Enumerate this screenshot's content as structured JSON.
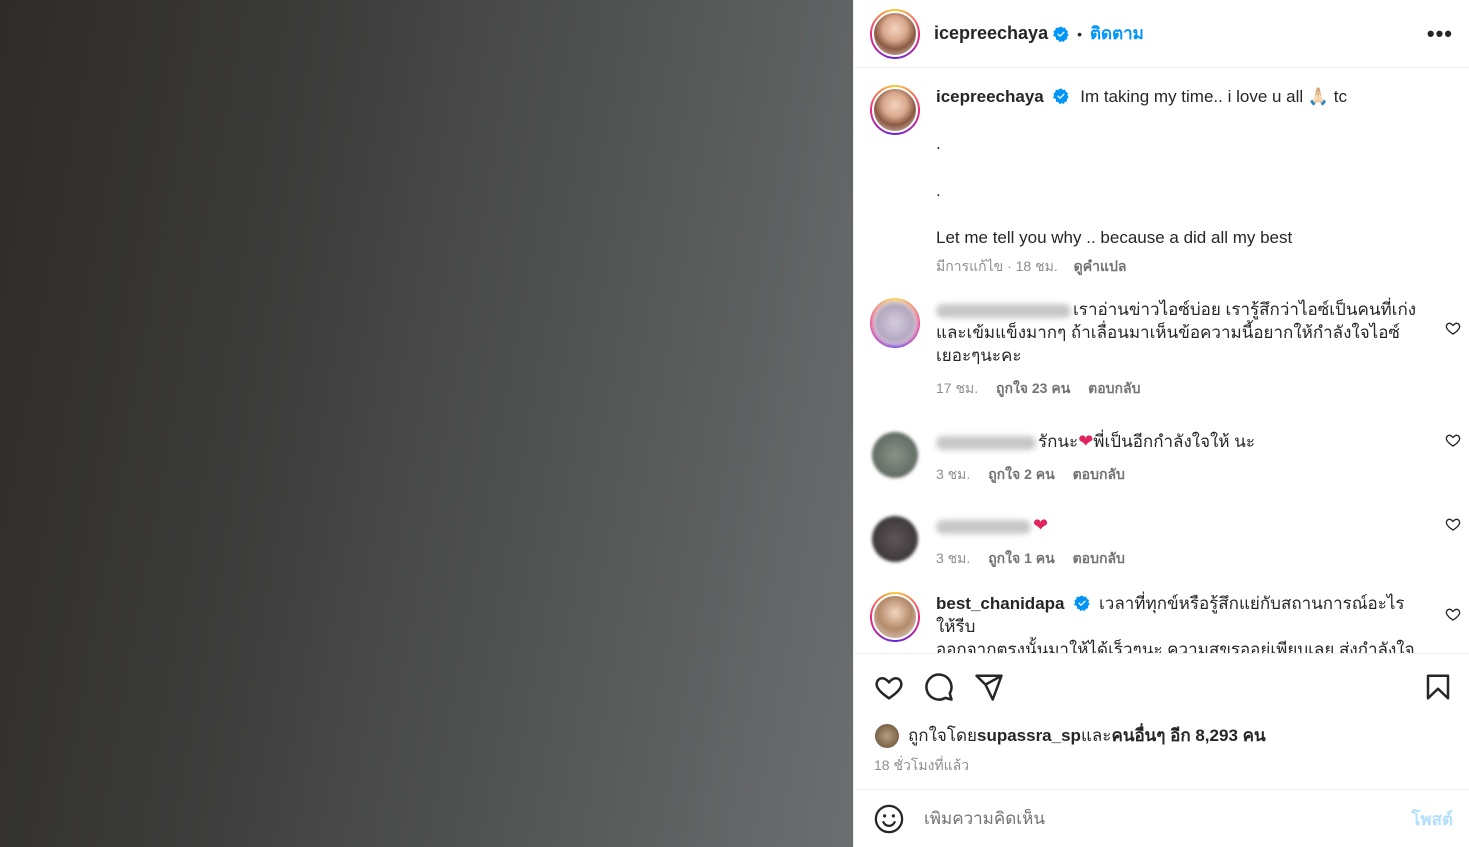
{
  "header": {
    "username": "icepreechaya",
    "dot": "•",
    "follow_label": "ติดตาม",
    "more_icon": "more-horizontal-icon"
  },
  "caption": {
    "username": "icepreechaya",
    "line1": "Im taking my time.. i love u all 🙏🏻 tc",
    "line2": ".",
    "line3": ".",
    "line4": "Let me tell you why .. because a did all my best",
    "edited": "มีการแก้ไข · 18 ชม.",
    "translate": "ดูคำแปล"
  },
  "comments": [
    {
      "text_line1": "เราอ่านข่าวไอซ์บ่อย เรารู้สึกว่าไอซ์เป็นคนที่เก่ง",
      "text_line2": "และเข้มแข็งมากๆ ถ้าเลื่อนมาเห็นข้อความนี้อยากให้กำลังใจไอซ์",
      "text_line3": "เยอะๆนะคะ",
      "time": "17 ชม.",
      "likes": "ถูกใจ 23 คน",
      "reply": "ตอบกลับ"
    },
    {
      "text_a": "รักนะ",
      "text_b": "พี่เป็นอีกกำลังใจให้ นะ",
      "time": "3 ชม.",
      "likes": "ถูกใจ 2 คน",
      "reply": "ตอบกลับ"
    },
    {
      "time": "3 ชม.",
      "likes": "ถูกใจ 1 คน",
      "reply": "ตอบกลับ"
    },
    {
      "username": "best_chanidapa",
      "text_line1": "เวลาที่ทุกข์หรือรู้สึกแย่กับสถานการณ์อะไร ให้รีบ",
      "text_line2": "ออกจากตรงนั้นมาให้ได้เร็วๆนะ ความสุขรออยู่เพียบเลย ส่งกำลังใจให้"
    }
  ],
  "likes": {
    "prefix": "ถูกใจโดย ",
    "user": "supassra_sp",
    "mid": " และ",
    "others": "คนอื่นๆ อีก 8,293 คน"
  },
  "time_ago": "18 ชั่วโมงที่แล้ว",
  "add_comment": {
    "placeholder": "เพิ่มความคิดเห็น",
    "post_label": "โพสต์"
  },
  "colors": {
    "accent": "#0095f6",
    "heart_red": "#e0245e"
  }
}
